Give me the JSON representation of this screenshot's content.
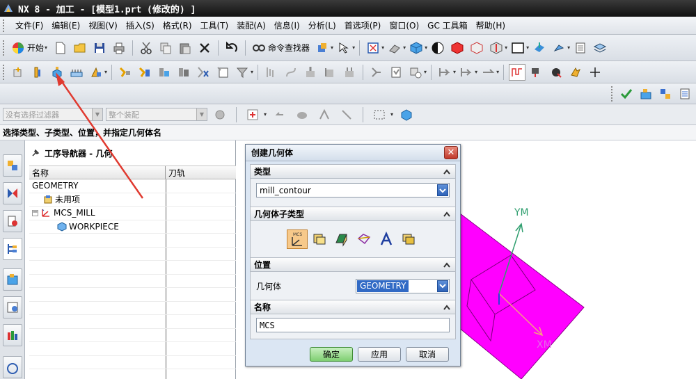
{
  "window": {
    "title": "NX 8 - 加工 - [模型1.prt  (修改的) ]"
  },
  "menu": [
    "文件(F)",
    "编辑(E)",
    "视图(V)",
    "插入(S)",
    "格式(R)",
    "工具(T)",
    "装配(A)",
    "信息(I)",
    "分析(L)",
    "首选项(P)",
    "窗口(O)",
    "GC 工具箱",
    "帮助(H)"
  ],
  "toolbar": {
    "start_label": "开始",
    "command_finder_label": "命令查找器"
  },
  "filter": {
    "type_filter": "没有选择过滤器",
    "assembly_filter": "整个装配"
  },
  "cue_line": "选择类型、子类型、位置，并指定几何体名",
  "navigator": {
    "title": "工序导航器 - 几何",
    "columns": [
      "名称",
      "刀轨"
    ],
    "rows": [
      {
        "name": "GEOMETRY",
        "level": 0
      },
      {
        "name": "未用项",
        "level": 1
      },
      {
        "name": "MCS_MILL",
        "level": 1
      },
      {
        "name": "WORKPIECE",
        "level": 2
      }
    ]
  },
  "dialog": {
    "title": "创建几何体",
    "close": "✕",
    "type_section": "类型",
    "type_value": "mill_contour",
    "subtype_section": "几何体子类型",
    "mcs_icon_label": "MCS",
    "position_section": "位置",
    "geometry_label": "几何体",
    "geometry_value": "GEOMETRY",
    "name_section": "名称",
    "name_value": "MCS",
    "ok": "确定",
    "apply": "应用",
    "cancel": "取消"
  },
  "viewport": {
    "axis_y": "YM",
    "axis_x": "XM",
    "part_color": "#ff00ff"
  },
  "colors": {
    "annotation_arrow": "#e03a30",
    "axis": "#2e9e6e"
  },
  "icons": [
    "new-file-icon",
    "open-folder-icon",
    "save-icon",
    "print-icon",
    "cut-icon",
    "copy-icon",
    "paste-icon",
    "delete-icon",
    "undo-icon",
    "command-finder-icon",
    "create-geometry-icon",
    "fit-view-icon",
    "shaded-view-icon",
    "close-icon"
  ]
}
